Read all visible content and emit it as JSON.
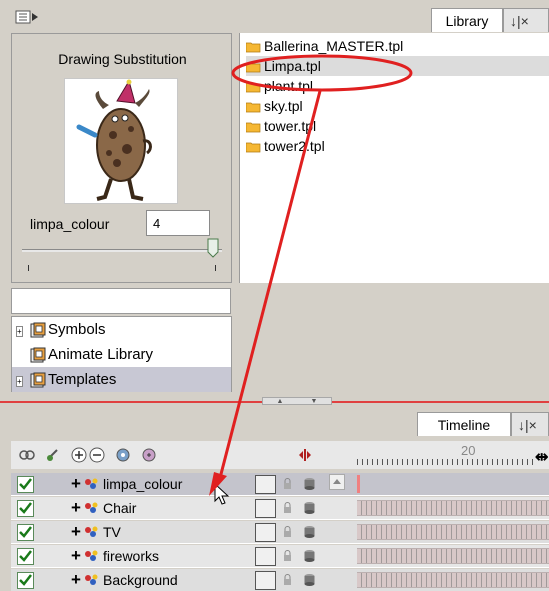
{
  "top_tabs": {
    "library": "Library",
    "controls_glyph": "↓|×"
  },
  "preview": {
    "title": "Drawing Substitution",
    "param_label": "limpa_colour",
    "param_value": "4",
    "slider_value": 4
  },
  "files": [
    {
      "name": "Ballerina_MASTER.tpl",
      "selected": false
    },
    {
      "name": "Limpa.tpl",
      "selected": true
    },
    {
      "name": "plant.tpl",
      "selected": false
    },
    {
      "name": "sky.tpl",
      "selected": false
    },
    {
      "name": "tower.tpl",
      "selected": false
    },
    {
      "name": "tower2.tpl",
      "selected": false
    }
  ],
  "tree": [
    {
      "label": "Symbols",
      "expander": "+"
    },
    {
      "label": "Animate Library",
      "expander": ""
    },
    {
      "label": "Templates",
      "expander": "+",
      "selected": true
    }
  ],
  "timeline": {
    "tab": "Timeline",
    "controls_glyph": "↓|×",
    "frame_marker": "20",
    "layers": [
      {
        "name": "limpa_colour",
        "checked": true,
        "selected": true
      },
      {
        "name": "Chair",
        "checked": true
      },
      {
        "name": "TV",
        "checked": true
      },
      {
        "name": "fireworks",
        "checked": true
      },
      {
        "name": "Background",
        "checked": true
      }
    ]
  },
  "colors": {
    "annotation": "#e02020",
    "folder": "#f5b733",
    "checkmark": "#1a7a1a"
  }
}
